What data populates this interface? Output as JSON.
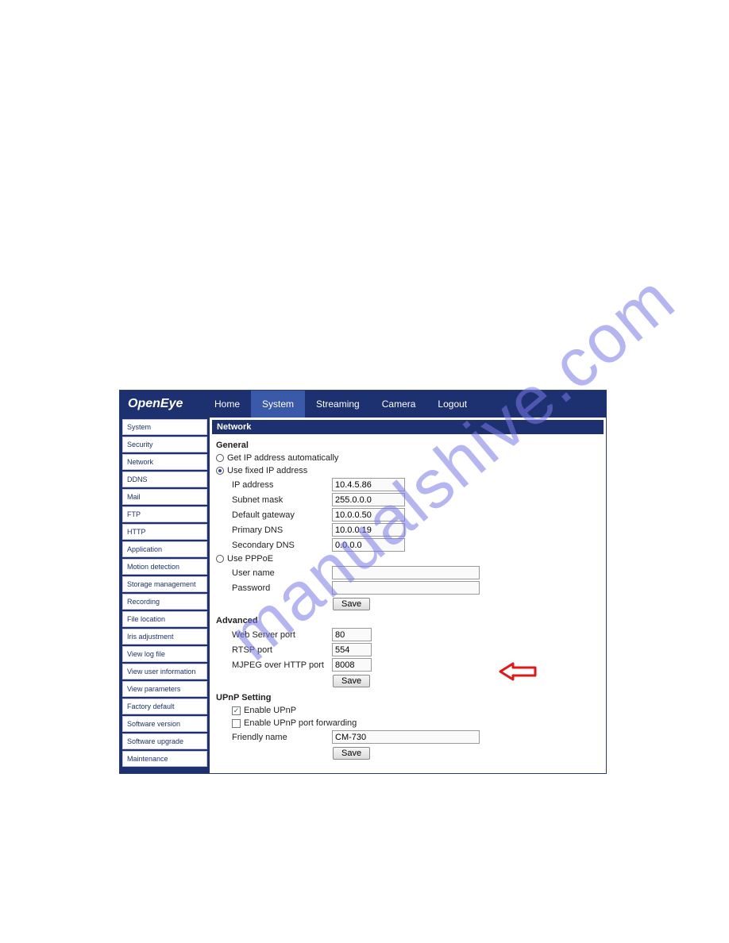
{
  "watermark": "manualshive.com",
  "brand": "OpenEye",
  "nav": {
    "items": [
      {
        "label": "Home",
        "active": false
      },
      {
        "label": "System",
        "active": true
      },
      {
        "label": "Streaming",
        "active": false
      },
      {
        "label": "Camera",
        "active": false
      },
      {
        "label": "Logout",
        "active": false
      }
    ]
  },
  "sidebar": {
    "items": [
      "System",
      "Security",
      "Network",
      "DDNS",
      "Mail",
      "FTP",
      "HTTP",
      "Application",
      "Motion detection",
      "Storage management",
      "Recording",
      "File location",
      "Iris adjustment",
      "View log file",
      "View user information",
      "View parameters",
      "Factory default",
      "Software version",
      "Software upgrade",
      "Maintenance"
    ]
  },
  "main": {
    "title": "Network",
    "general": {
      "heading": "General",
      "opt_auto": "Get IP address automatically",
      "opt_fixed": "Use fixed IP address",
      "ip_label": "IP address",
      "ip_value": "10.4.5.86",
      "mask_label": "Subnet mask",
      "mask_value": "255.0.0.0",
      "gw_label": "Default gateway",
      "gw_value": "10.0.0.50",
      "dns1_label": "Primary DNS",
      "dns1_value": "10.0.0.19",
      "dns2_label": "Secondary DNS",
      "dns2_value": "0.0.0.0",
      "opt_pppoe": "Use PPPoE",
      "user_label": "User name",
      "user_value": "",
      "pass_label": "Password",
      "pass_value": "",
      "save": "Save"
    },
    "advanced": {
      "heading": "Advanced",
      "web_label": "Web Server port",
      "web_value": "80",
      "rtsp_label": "RTSP port",
      "rtsp_value": "554",
      "mjpeg_label": "MJPEG over HTTP port",
      "mjpeg_value": "8008",
      "save": "Save"
    },
    "upnp": {
      "heading": "UPnP Setting",
      "enable_label": "Enable UPnP",
      "enable_checked": true,
      "fwd_label": "Enable UPnP port forwarding",
      "fwd_checked": false,
      "friendly_label": "Friendly name",
      "friendly_value": "CM-730",
      "save": "Save"
    }
  }
}
